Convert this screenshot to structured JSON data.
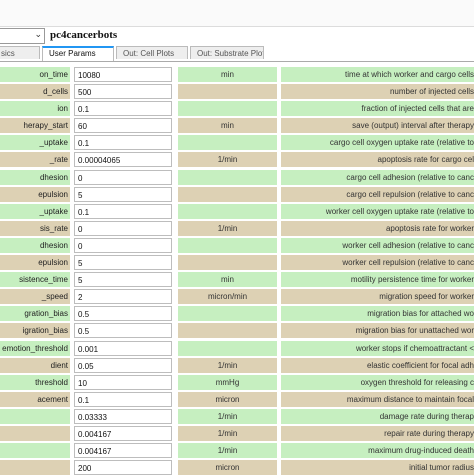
{
  "model": {
    "name": "pc4cancerbots",
    "select_chevron": "chevron-down-icon"
  },
  "tabs": [
    {
      "label": "sics",
      "active": false
    },
    {
      "label": "User Params",
      "active": true
    },
    {
      "label": "Out: Cell Plots",
      "active": false
    },
    {
      "label": "Out: Substrate Plots",
      "active": false
    }
  ],
  "row_colors": {
    "green": "#c6efc0",
    "tan": "#ddd1b4"
  },
  "params": [
    {
      "name": "on_time",
      "value": "10080",
      "unit": "min",
      "desc": "time at which worker and cargo cells",
      "color": "green"
    },
    {
      "name": "d_cells",
      "value": "500",
      "unit": "",
      "desc": "number of injected cells",
      "color": "tan"
    },
    {
      "name": "ion",
      "value": "0.1",
      "unit": "",
      "desc": "fraction of injected cells that are",
      "color": "green"
    },
    {
      "name": "herapy_start",
      "value": "60",
      "unit": "min",
      "desc": "save (output) interval after therapy",
      "color": "tan"
    },
    {
      "name": "_uptake",
      "value": "0.1",
      "unit": "",
      "desc": "cargo cell oxygen uptake rate (relative to",
      "color": "green"
    },
    {
      "name": "_rate",
      "value": "0.00004065",
      "unit": "1/min",
      "desc": "apoptosis rate for cargo cel",
      "color": "tan"
    },
    {
      "name": "dhesion",
      "value": "0",
      "unit": "",
      "desc": "cargo cell adhesion (relative to canc",
      "color": "green"
    },
    {
      "name": "epulsion",
      "value": "5",
      "unit": "",
      "desc": "cargo cell repulsion (relative to canc",
      "color": "tan"
    },
    {
      "name": "_uptake",
      "value": "0.1",
      "unit": "",
      "desc": "worker cell oxygen uptake rate (relative to",
      "color": "green"
    },
    {
      "name": "sis_rate",
      "value": "0",
      "unit": "1/min",
      "desc": "apoptosis rate for worker",
      "color": "tan"
    },
    {
      "name": "dhesion",
      "value": "0",
      "unit": "",
      "desc": "worker cell adhesion (relative to canc",
      "color": "green"
    },
    {
      "name": "epulsion",
      "value": "5",
      "unit": "",
      "desc": "worker cell repulsion (relative to canc",
      "color": "tan"
    },
    {
      "name": "sistence_time",
      "value": "5",
      "unit": "min",
      "desc": "motility persistence time for worker",
      "color": "green"
    },
    {
      "name": "_speed",
      "value": "2",
      "unit": "micron/min",
      "desc": "migration speed for worker",
      "color": "tan"
    },
    {
      "name": "gration_bias",
      "value": "0.5",
      "unit": "",
      "desc": "migration bias for attached wo",
      "color": "green"
    },
    {
      "name": "igration_bias",
      "value": "0.5",
      "unit": "",
      "desc": "migration bias for unattached wor",
      "color": "tan"
    },
    {
      "name": "emotion_threshold",
      "value": "0.001",
      "unit": "",
      "desc": "worker stops if chemoattractant <",
      "color": "green"
    },
    {
      "name": "dient",
      "value": "0.05",
      "unit": "1/min",
      "desc": "elastic coefficient for focal adh",
      "color": "tan"
    },
    {
      "name": "threshold",
      "value": "10",
      "unit": "mmHg",
      "desc": "oxygen threshold for releasing c",
      "color": "green"
    },
    {
      "name": "acement",
      "value": "0.1",
      "unit": "micron",
      "desc": "maximum distance to maintain focal",
      "color": "tan"
    },
    {
      "name": "",
      "value": "0.03333",
      "unit": "1/min",
      "desc": "damage rate during therap",
      "color": "green"
    },
    {
      "name": "",
      "value": "0.004167",
      "unit": "1/min",
      "desc": "repair rate during therapy",
      "color": "tan"
    },
    {
      "name": "",
      "value": "0.004167",
      "unit": "1/min",
      "desc": "maximum drug-induced death",
      "color": "green"
    },
    {
      "name": "",
      "value": "200",
      "unit": "micron",
      "desc": "initial tumor radius",
      "color": "tan"
    }
  ]
}
